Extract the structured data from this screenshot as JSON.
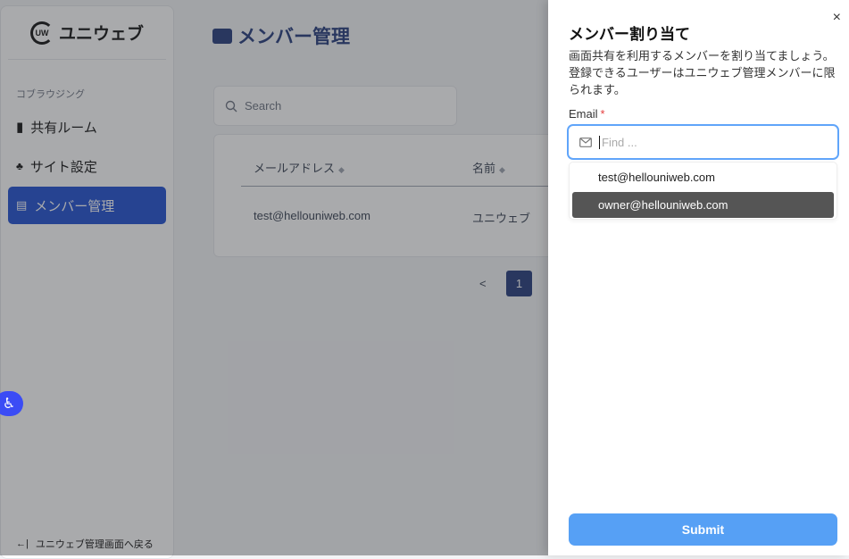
{
  "sidebar": {
    "brand": "ユニウェブ",
    "logo_mark": "UW",
    "section": "コブラウジング",
    "items": [
      {
        "label": "共有ルーム",
        "icon": "door-icon"
      },
      {
        "label": "サイト設定",
        "icon": "sitemap-icon"
      },
      {
        "label": "メンバー管理",
        "icon": "id-card-icon",
        "active": true
      }
    ],
    "back": "ユニウェブ管理画面へ戻る"
  },
  "main": {
    "title": "メンバー管理",
    "search_placeholder": "Search",
    "columns": [
      "メールアドレス",
      "名前"
    ],
    "rows": [
      [
        "test@hellouniweb.com",
        "ユニウェブ"
      ]
    ],
    "pagination": {
      "prev": "<",
      "current": "1"
    }
  },
  "drawer": {
    "title": "メンバー割り当て",
    "description": "画面共有を利用するメンバーを割り当てましょう。登録できるユーザーはユニウェブ管理メンバーに限られます。",
    "email_label": "Email",
    "required": "*",
    "placeholder": "Find ...",
    "options": [
      "test@hellouniweb.com",
      "owner@hellouniweb.com"
    ],
    "highlighted_option": "owner@hellouniweb.com",
    "submit": "Submit",
    "close": "×"
  },
  "colors": {
    "accent": "#1e4fd1",
    "submit": "#56a0f5",
    "title": "#233a7a",
    "a11y": "#3b4cf5"
  }
}
